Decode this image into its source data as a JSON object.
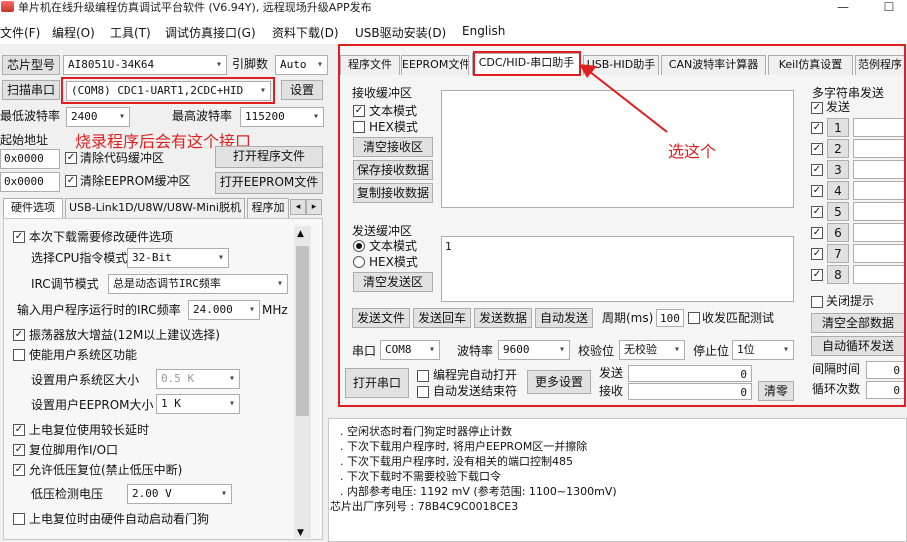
{
  "window": {
    "title": "单片机在线升级编程仿真调试平台软件 (V6.94Y), 远程现场升级APP发布",
    "minimize": "—",
    "maximize": "☐"
  },
  "menu": [
    "文件(F)",
    "编程(O)",
    "工具(T)",
    "调试仿真接口(G)",
    "资料下载(D)",
    "USB驱动安装(D)",
    "English"
  ],
  "left": {
    "chip_label": "芯片型号",
    "chip_value": "AI8051U-34K64",
    "pin_label": "引脚数",
    "pin_value": "Auto",
    "scan_btn": "扫描串口",
    "port_value": "(COM8) CDC1-UART1,2CDC+HID",
    "settings_btn": "设置",
    "min_baud_label": "最低波特率",
    "min_baud_value": "2400",
    "max_baud_label": "最高波特率",
    "max_baud_value": "115200",
    "start_addr_label": "起始地址",
    "addr1": "0x0000",
    "clear_code": "清除代码缓冲区",
    "open_prog_btn": "打开程序文件",
    "addr2": "0x0000",
    "clear_eeprom": "清除EEPROM缓冲区",
    "open_eeprom_btn": "打开EEPROM文件",
    "tabs": [
      "硬件选项",
      "USB-Link1D/U8W/U8W-Mini脱机",
      "程序加"
    ],
    "options": {
      "opt1": "本次下载需要修改硬件选项",
      "cpu_mode_label": "选择CPU指令模式",
      "cpu_mode_value": "32-Bit",
      "irc_label": "IRC调节模式",
      "irc_value": "总是动态调节IRC频率",
      "freq_label": "输入用户程序运行时的IRC频率",
      "freq_value": "24.000",
      "freq_unit": "MHz",
      "opt_amp": "振荡器放大增益(12M以上建议选择)",
      "opt_sysarea": "使能用户系统区功能",
      "sysarea_label": "设置用户系统区大小",
      "sysarea_value": "0.5 K",
      "eeprom_size_label": "设置用户EEPROM大小",
      "eeprom_size_value": "1   K",
      "opt_delay": "上电复位使用较长延时",
      "opt_reset": "复位脚用作I/O口",
      "opt_lowvolt": "允许低压复位(禁止低压中断)",
      "lowvolt_label": "低压检测电压",
      "lowvolt_value": "2.00 V",
      "opt_watchdog": "上电复位时由硬件自动启动看门狗"
    }
  },
  "annotations": {
    "port_note": "烧录程序后会有这个接口",
    "tab_note": "选这个"
  },
  "right": {
    "tabs": [
      "程序文件",
      "EEPROM文件",
      "CDC/HID-串口助手",
      "USB-HID助手",
      "CAN波特率计算器",
      "Keil仿真设置",
      "范例程序"
    ],
    "recv": {
      "title": "接收缓冲区",
      "text_mode": "文本模式",
      "hex_mode": "HEX模式",
      "clear_btn": "清空接收区",
      "save_btn": "保存接收数据",
      "copy_btn": "复制接收数据"
    },
    "send": {
      "title": "发送缓冲区",
      "text_mode": "文本模式",
      "hex_mode": "HEX模式",
      "clear_btn": "清空发送区",
      "content": "1"
    },
    "actions": {
      "send_file": "发送文件",
      "send_return": "发送回车",
      "send_data": "发送数据",
      "auto_send": "自动发送",
      "period_label": "周期(ms)",
      "period_value": "100",
      "match_test": "收发匹配测试"
    },
    "serial": {
      "port_label": "串口",
      "port_value": "COM8",
      "baud_label": "波特率",
      "baud_value": "9600",
      "parity_label": "校验位",
      "parity_value": "无校验",
      "stop_label": "停止位",
      "stop_value": "1位",
      "open_btn": "打开串口",
      "auto_open": "编程完自动打开",
      "auto_send_end": "自动发送结束符",
      "more_btn": "更多设置",
      "send_label": "发送",
      "send_count": "0",
      "recv_label": "接收",
      "recv_count": "0",
      "clear_count_btn": "清零"
    },
    "multi": {
      "title": "多字符串发送",
      "send_col": "发送",
      "rows": [
        "1",
        "2",
        "3",
        "4",
        "5",
        "6",
        "7",
        "8"
      ],
      "close_tip": "关闭提示",
      "clear_all": "清空全部数据",
      "auto_loop": "自动循环发送",
      "interval_label": "间隔时间",
      "interval_value": "0",
      "loop_label": "循环次数",
      "loop_value": "0"
    }
  },
  "log": {
    "lines": [
      ". 空闲状态时看门狗定时器停止计数",
      ". 下次下载用户程序时, 将用户EEPROM区一并擦除",
      ". 下次下载用户程序时, 没有相关的端口控制485",
      ". 下次下载时不需要校验下载口令",
      ". 内部参考电压: 1192 mV (参考范围: 1100~1300mV)",
      "芯片出厂序列号 : 78B4C9C0018CE3"
    ]
  },
  "colors": {
    "annotation": "#e02020",
    "window_bg": "#f0f0f0"
  }
}
